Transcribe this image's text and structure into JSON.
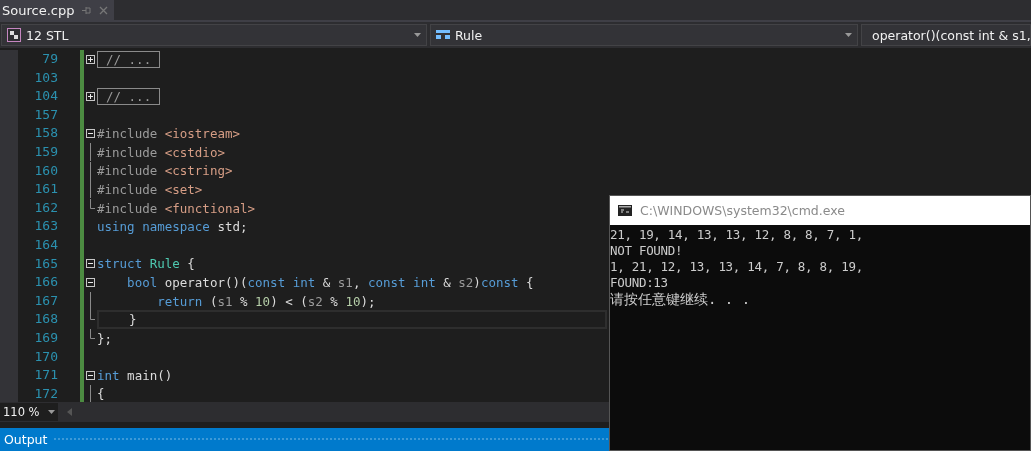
{
  "tab": {
    "title": "Source.cpp",
    "selected": true
  },
  "nav_bar": [
    {
      "kind": "project",
      "label": "12 STL"
    },
    {
      "kind": "scope",
      "label": "Rule"
    },
    {
      "kind": "member",
      "label": "operator()(const int & s1,"
    }
  ],
  "editor": {
    "lines": [
      {
        "number": "79",
        "fold_marker": {
          "kind": "expand"
        },
        "current": false,
        "tokens": [
          {
            "text": "// ...",
            "kind": "collapsed"
          }
        ]
      },
      {
        "number": "103",
        "current": false
      },
      {
        "number": "104",
        "fold_marker": {
          "kind": "expand"
        },
        "current": false,
        "tokens": [
          {
            "text": "// ...",
            "kind": "collapsed"
          }
        ]
      },
      {
        "number": "157",
        "current": false
      },
      {
        "number": "158",
        "fold_marker": {
          "kind": "collapse"
        },
        "current": false,
        "tokens": [
          {
            "text": "#include ",
            "kind": "preproc"
          },
          {
            "text": "<iostream>",
            "kind": "string"
          }
        ]
      },
      {
        "number": "159",
        "fold_marker": {
          "kind": "line"
        },
        "current": false,
        "tokens": [
          {
            "text": "#include ",
            "kind": "preproc"
          },
          {
            "text": "<cstdio>",
            "kind": "string"
          }
        ]
      },
      {
        "number": "160",
        "fold_marker": {
          "kind": "line"
        },
        "current": false,
        "tokens": [
          {
            "text": "#include ",
            "kind": "preproc"
          },
          {
            "text": "<cstring>",
            "kind": "string"
          }
        ]
      },
      {
        "number": "161",
        "fold_marker": {
          "kind": "line"
        },
        "current": false,
        "tokens": [
          {
            "text": "#include ",
            "kind": "preproc"
          },
          {
            "text": "<set>",
            "kind": "string"
          }
        ]
      },
      {
        "number": "162",
        "fold_marker": {
          "kind": "end"
        },
        "current": false,
        "tokens": [
          {
            "text": "#include ",
            "kind": "preproc"
          },
          {
            "text": "<functional>",
            "kind": "string"
          }
        ]
      },
      {
        "number": "163",
        "current": false,
        "tokens": [
          {
            "text": "using namespace",
            "kind": "keyword"
          },
          {
            "text": " std;",
            "kind": "plain"
          }
        ]
      },
      {
        "number": "164",
        "current": false
      },
      {
        "number": "165",
        "fold_marker": {
          "kind": "collapse"
        },
        "current": false,
        "tokens": [
          {
            "text": "struct",
            "kind": "keyword"
          },
          {
            "text": " Rule",
            "kind": "type"
          },
          {
            "text": " {",
            "kind": "plain"
          }
        ]
      },
      {
        "number": "166",
        "fold_marker": {
          "kind": "collapse"
        },
        "current": false,
        "tokens": [
          {
            "text": "    bool",
            "kind": "keyword"
          },
          {
            "text": " operator()(",
            "kind": "plain"
          },
          {
            "text": "const int",
            "kind": "keyword"
          },
          {
            "text": " & ",
            "kind": "plain"
          },
          {
            "text": "s1",
            "kind": "param"
          },
          {
            "text": ", ",
            "kind": "plain"
          },
          {
            "text": "const int",
            "kind": "keyword"
          },
          {
            "text": " & ",
            "kind": "plain"
          },
          {
            "text": "s2",
            "kind": "param"
          },
          {
            "text": ")",
            "kind": "plain"
          },
          {
            "text": "const",
            "kind": "keyword"
          },
          {
            "text": " {",
            "kind": "plain"
          }
        ]
      },
      {
        "number": "167",
        "fold_marker": {
          "kind": "line"
        },
        "current": false,
        "tokens": [
          {
            "text": "        return",
            "kind": "keyword"
          },
          {
            "text": " (",
            "kind": "plain"
          },
          {
            "text": "s1",
            "kind": "param"
          },
          {
            "text": " % ",
            "kind": "plain"
          },
          {
            "text": "10",
            "kind": "number"
          },
          {
            "text": ") < (",
            "kind": "plain"
          },
          {
            "text": "s2",
            "kind": "param"
          },
          {
            "text": " % ",
            "kind": "plain"
          },
          {
            "text": "10",
            "kind": "number"
          },
          {
            "text": ");",
            "kind": "plain"
          }
        ]
      },
      {
        "number": "168",
        "fold_marker": {
          "kind": "end"
        },
        "current": true,
        "tokens": [
          {
            "text": "    }",
            "kind": "plain"
          }
        ]
      },
      {
        "number": "169",
        "fold_marker": {
          "kind": "end"
        },
        "current": false,
        "tokens": [
          {
            "text": "};",
            "kind": "plain"
          }
        ]
      },
      {
        "number": "170",
        "current": false
      },
      {
        "number": "171",
        "fold_marker": {
          "kind": "collapse"
        },
        "current": false,
        "tokens": [
          {
            "text": "int",
            "kind": "keyword"
          },
          {
            "text": " main()",
            "kind": "plain"
          }
        ]
      },
      {
        "number": "172",
        "fold_marker": {
          "kind": "line"
        },
        "current": false,
        "tokens": [
          {
            "text": "{",
            "kind": "plain"
          }
        ]
      }
    ]
  },
  "zoom": {
    "value": "110 %"
  },
  "output_panel": {
    "title": "Output"
  },
  "console": {
    "title": "C:\\WINDOWS\\system32\\cmd.exe",
    "lines": [
      "21, 19, 14, 13, 13, 12, 8, 8, 7, 1,",
      "NOT FOUND!",
      "1, 21, 12, 13, 13, 14, 7, 8, 8, 19,",
      "FOUND:13",
      "请按任意键继续. . ."
    ]
  }
}
